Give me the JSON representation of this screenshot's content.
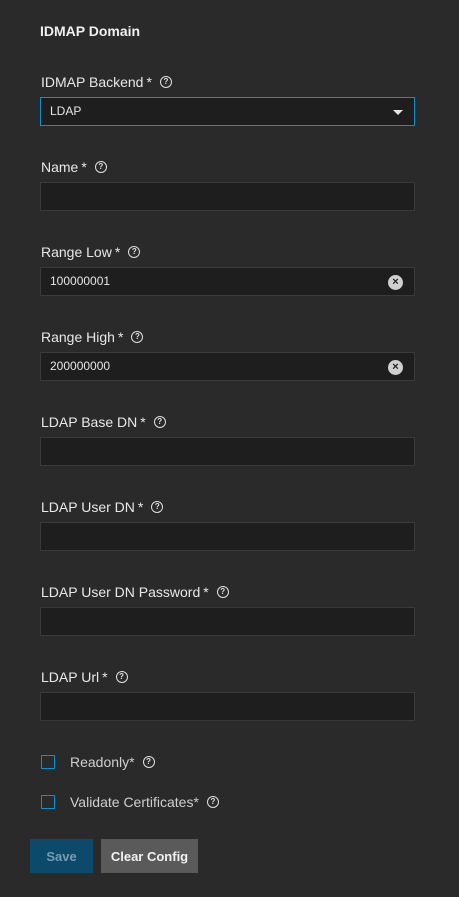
{
  "form": {
    "title": "IDMAP Domain",
    "required_marker": "*",
    "help_glyph": "?",
    "clear_glyph": "×",
    "fields": {
      "backend": {
        "label": "IDMAP Backend",
        "value": "LDAP"
      },
      "name": {
        "label": "Name",
        "value": ""
      },
      "range_low": {
        "label": "Range Low",
        "value": "100000001"
      },
      "range_high": {
        "label": "Range High",
        "value": "200000000"
      },
      "ldap_base_dn": {
        "label": "LDAP Base DN",
        "value": ""
      },
      "ldap_user_dn": {
        "label": "LDAP User DN",
        "value": ""
      },
      "ldap_user_dn_password": {
        "label": "LDAP User DN Password",
        "value": ""
      },
      "ldap_url": {
        "label": "LDAP Url",
        "value": ""
      }
    },
    "checkboxes": {
      "readonly": {
        "label": "Readonly",
        "checked": false
      },
      "validate_certificates": {
        "label": "Validate Certificates",
        "checked": false
      }
    },
    "buttons": {
      "save": "Save",
      "clear_config": "Clear Config"
    }
  },
  "colors": {
    "background": "#2a2a2a",
    "input_background": "#1e1e1e",
    "accent": "#0095d5",
    "save_button_disabled": "#0b4a6a",
    "secondary_button": "#5a5a5a"
  }
}
